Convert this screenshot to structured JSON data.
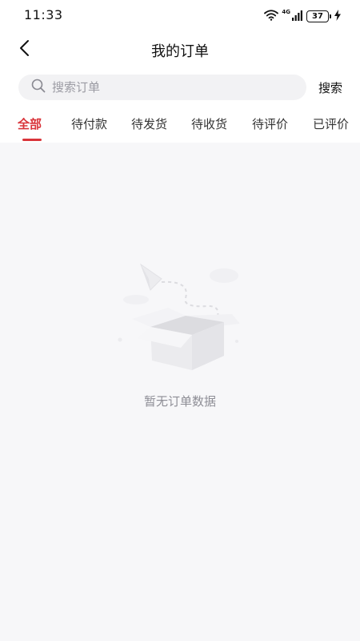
{
  "status_bar": {
    "time": "11:33",
    "network": "4G",
    "battery": "37",
    "icons": [
      "wifi-icon",
      "signal-icon",
      "battery-icon",
      "charging-icon"
    ]
  },
  "nav": {
    "back_icon": "chevron-left-icon",
    "title": "我的订单"
  },
  "search": {
    "placeholder": "搜索订单",
    "value": "",
    "icon": "search-icon",
    "button_label": "搜索"
  },
  "tabs": [
    {
      "label": "全部",
      "active": true
    },
    {
      "label": "待付款",
      "active": false
    },
    {
      "label": "待发货",
      "active": false
    },
    {
      "label": "待收货",
      "active": false
    },
    {
      "label": "待评价",
      "active": false
    },
    {
      "label": "已评价",
      "active": false
    }
  ],
  "empty_state": {
    "illustration": "empty-box-icon",
    "message": "暂无订单数据"
  },
  "colors": {
    "accent": "#d9343a",
    "background": "#f7f7f9",
    "surface": "#ffffff",
    "muted_text": "#8e8e96"
  }
}
